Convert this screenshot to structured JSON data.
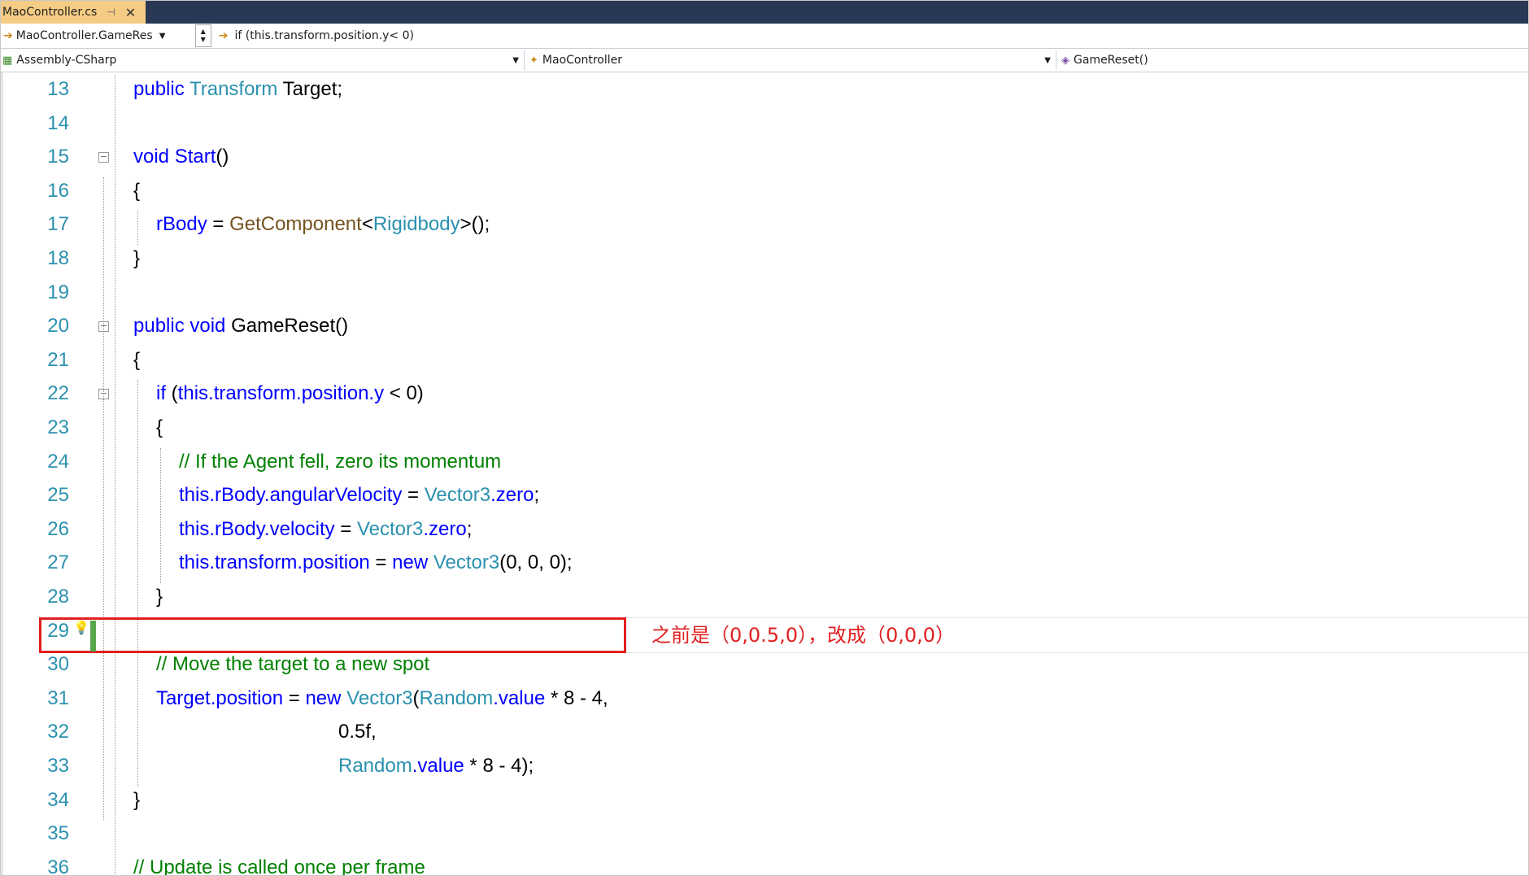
{
  "tab": {
    "title": "MaoController.cs",
    "pin": "⊣",
    "close": "✕"
  },
  "navbar1": {
    "member": "MaoController.GameRes",
    "condition": "if (this.transform.position.y< 0)"
  },
  "navbar2": {
    "project": "Assembly-CSharp",
    "class": "MaoController",
    "method": "GameReset()"
  },
  "annotation": "之前是（0,0.5,0），改成（0,0,0）",
  "colors": {
    "keyword": "#0000ff",
    "type": "#2b91af",
    "method": "#74531f",
    "comment": "#008000",
    "annotation": "#e02020"
  },
  "lines": [
    {
      "n": "13",
      "indent": 0,
      "tokens": [
        [
          "kw",
          "public "
        ],
        [
          "ty",
          "Transform"
        ],
        [
          "",
          " Target;"
        ]
      ]
    },
    {
      "n": "14",
      "indent": 0,
      "tokens": []
    },
    {
      "n": "15",
      "indent": 0,
      "fold": true,
      "tokens": [
        [
          "kw",
          "void "
        ],
        [
          "kw",
          "Start"
        ],
        [
          "",
          "()"
        ]
      ]
    },
    {
      "n": "16",
      "indent": 0,
      "tokens": [
        [
          "",
          "{"
        ]
      ]
    },
    {
      "n": "17",
      "indent": 1,
      "tokens": [
        [
          "kw",
          "rBody"
        ],
        [
          "",
          " = "
        ],
        [
          "mt",
          "GetComponent"
        ],
        [
          "",
          "<"
        ],
        [
          "ty",
          "Rigidbody"
        ],
        [
          "",
          ">();"
        ]
      ]
    },
    {
      "n": "18",
      "indent": 0,
      "tokens": [
        [
          "",
          "}"
        ]
      ]
    },
    {
      "n": "19",
      "indent": 0,
      "tokens": []
    },
    {
      "n": "20",
      "indent": 0,
      "fold": true,
      "tokens": [
        [
          "kw",
          "public void "
        ],
        [
          "",
          "GameReset()"
        ]
      ]
    },
    {
      "n": "21",
      "indent": 0,
      "tokens": [
        [
          "",
          "{"
        ]
      ]
    },
    {
      "n": "22",
      "indent": 1,
      "fold": true,
      "tokens": [
        [
          "kw",
          "if "
        ],
        [
          "",
          "("
        ],
        [
          "kw",
          "this.transform.position.y"
        ],
        [
          "",
          " < 0)"
        ]
      ]
    },
    {
      "n": "23",
      "indent": 1,
      "tokens": [
        [
          "",
          "{"
        ]
      ]
    },
    {
      "n": "24",
      "indent": 2,
      "tokens": [
        [
          "cm",
          "// If the Agent fell, zero its momentum"
        ]
      ]
    },
    {
      "n": "25",
      "indent": 2,
      "tokens": [
        [
          "kw",
          "this.rBody.angularVelocity"
        ],
        [
          "",
          " = "
        ],
        [
          "ty",
          "Vector3"
        ],
        [
          "kw",
          ".zero"
        ],
        [
          "",
          ";"
        ]
      ]
    },
    {
      "n": "26",
      "indent": 2,
      "tokens": [
        [
          "kw",
          "this.rBody.velocity"
        ],
        [
          "",
          " = "
        ],
        [
          "ty",
          "Vector3"
        ],
        [
          "kw",
          ".zero"
        ],
        [
          "",
          ";"
        ]
      ]
    },
    {
      "n": "27",
      "indent": 2,
      "tokens": [
        [
          "kw",
          "this.transform.position"
        ],
        [
          "",
          " = "
        ],
        [
          "kw",
          "new "
        ],
        [
          "ty",
          "Vector3"
        ],
        [
          "",
          "(0, 0, 0);"
        ]
      ]
    },
    {
      "n": "28",
      "indent": 1,
      "tokens": [
        [
          "",
          "}"
        ]
      ]
    },
    {
      "n": "29",
      "indent": 0,
      "tokens": []
    },
    {
      "n": "30",
      "indent": 1,
      "tokens": [
        [
          "cm",
          "// Move the target to a new spot"
        ]
      ]
    },
    {
      "n": "31",
      "indent": 1,
      "tokens": [
        [
          "kw",
          "Target.position"
        ],
        [
          "",
          " = "
        ],
        [
          "kw",
          "new "
        ],
        [
          "ty",
          "Vector3"
        ],
        [
          "",
          "("
        ],
        [
          "ty",
          "Random"
        ],
        [
          "kw",
          ".value"
        ],
        [
          "",
          " * 8 - 4,"
        ]
      ]
    },
    {
      "n": "32",
      "indent": 9,
      "tokens": [
        [
          "",
          "0.5f,"
        ]
      ]
    },
    {
      "n": "33",
      "indent": 9,
      "tokens": [
        [
          "ty",
          "Random"
        ],
        [
          "kw",
          ".value"
        ],
        [
          "",
          " * 8 - 4);"
        ]
      ]
    },
    {
      "n": "34",
      "indent": 0,
      "tokens": [
        [
          "",
          "}"
        ]
      ]
    },
    {
      "n": "35",
      "indent": 0,
      "tokens": []
    },
    {
      "n": "36",
      "indent": 0,
      "tokens": [
        [
          "cm",
          "// Update is called once per frame"
        ]
      ]
    }
  ]
}
